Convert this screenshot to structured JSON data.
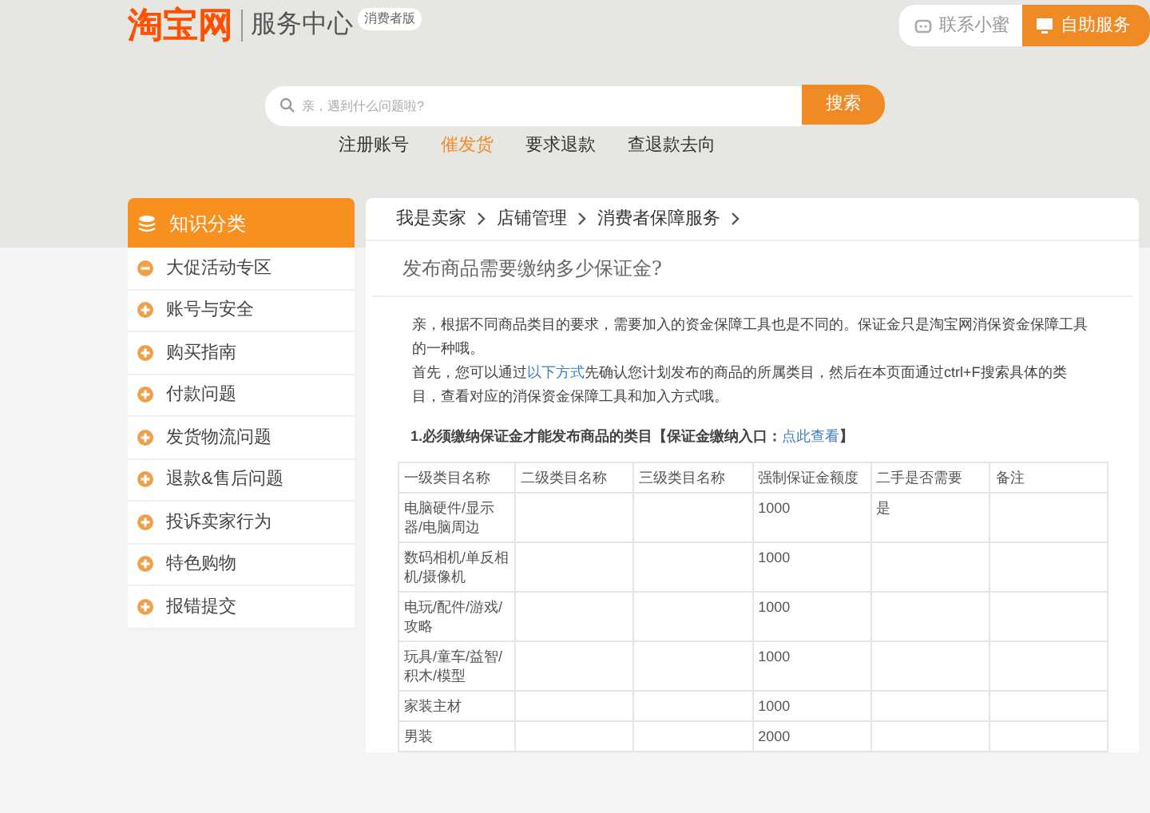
{
  "header": {
    "logo": "淘宝网",
    "site_name": "服务中心",
    "badge": "消费者版",
    "contact_button": "联系小蜜",
    "self_service_button": "自助服务"
  },
  "search": {
    "placeholder": "亲，遇到什么问题啦?",
    "button": "搜索"
  },
  "quick_links": [
    {
      "label": "注册账号",
      "selected": false
    },
    {
      "label": "催发货",
      "selected": true
    },
    {
      "label": "要求退款",
      "selected": false
    },
    {
      "label": "查退款去向",
      "selected": false
    }
  ],
  "sidebar": {
    "title": "知识分类",
    "items": [
      {
        "label": "大促活动专区",
        "expanded": true
      },
      {
        "label": "账号与安全",
        "expanded": false
      },
      {
        "label": "购买指南",
        "expanded": false
      },
      {
        "label": "付款问题",
        "expanded": false
      },
      {
        "label": "发货物流问题",
        "expanded": false
      },
      {
        "label": "退款&售后问题",
        "expanded": false
      },
      {
        "label": "投诉卖家行为",
        "expanded": false
      },
      {
        "label": "特色购物",
        "expanded": false
      },
      {
        "label": "报错提交",
        "expanded": false
      }
    ]
  },
  "breadcrumb": [
    "我是卖家",
    "店铺管理",
    "消费者保障服务"
  ],
  "article": {
    "title": "发布商品需要缴纳多少保证金?",
    "paragraph_1": "亲，根据不同商品类目的要求，需要加入的资金保障工具也是不同的。保证金只是淘宝网消保资金保障工具的一种哦。",
    "paragraph_2_before": "首先，您可以通过",
    "paragraph_2_link": "以下方式",
    "paragraph_2_after": "先确认您计划发布的商品的所属类目，然后在本页面通过ctrl+F搜索具体的类目，查看对应的消保资金保障工具和加入方式哦。",
    "section_heading": "1.必须缴纳保证金才能发布商品的类目【保证金缴纳入口：",
    "section_link": "点此查看",
    "section_heading_end": "】"
  },
  "table": {
    "columns": [
      "一级类目名称",
      "二级类目名称",
      "三级类目名称",
      "强制保证金额度",
      "二手是否需要",
      "备注"
    ],
    "rows": [
      [
        "电脑硬件/显示器/电脑周边",
        "",
        "",
        "1000",
        "是",
        ""
      ],
      [
        "数码相机/单反相机/摄像机",
        "",
        "",
        "1000",
        "",
        ""
      ],
      [
        "电玩/配件/游戏/攻略",
        "",
        "",
        "1000",
        "",
        ""
      ],
      [
        "玩具/童车/益智/积木/模型",
        "",
        "",
        "1000",
        "",
        ""
      ],
      [
        "家装主材",
        "",
        "",
        "1000",
        "",
        ""
      ],
      [
        "男装",
        "",
        "",
        "2000",
        "",
        ""
      ]
    ]
  }
}
